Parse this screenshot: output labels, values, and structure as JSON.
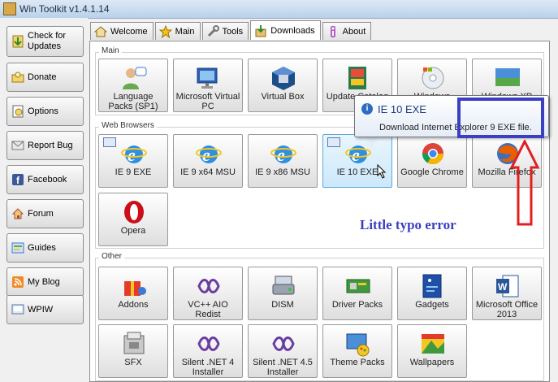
{
  "window": {
    "title": "Win Toolkit v1.4.1.14"
  },
  "sidebar": {
    "items": [
      {
        "label": "Check for Updates",
        "icon": "download-arrow-icon",
        "color": "#3d9b3d"
      },
      {
        "label": "Donate",
        "icon": "donate-icon",
        "color": "#d9a12e"
      },
      {
        "label": "Options",
        "icon": "options-icon",
        "color": "#3a6fb5"
      },
      {
        "label": "Report Bug",
        "icon": "report-bug-icon",
        "color": "#777777"
      },
      {
        "label": "Facebook",
        "icon": "facebook-icon",
        "color": "#3b5998"
      },
      {
        "label": "Forum",
        "icon": "forum-icon",
        "color": "#c0504d"
      },
      {
        "label": "Guides",
        "icon": "guides-icon",
        "color": "#6aa84f"
      },
      {
        "label": "My Blog",
        "icon": "blog-icon",
        "color": "#e8842a"
      },
      {
        "label": "WPIW",
        "icon": "wpiw-icon",
        "color": "#5577aa"
      }
    ]
  },
  "tabs": [
    {
      "label": "Welcome",
      "icon": "home-icon"
    },
    {
      "label": "Main",
      "icon": "star-icon"
    },
    {
      "label": "Tools",
      "icon": "tools-icon"
    },
    {
      "label": "Downloads",
      "icon": "downloads-icon",
      "active": true
    },
    {
      "label": "About",
      "icon": "info-icon"
    }
  ],
  "groups": {
    "main": {
      "title": "Main",
      "tiles": [
        {
          "label": "Language Packs (SP1)",
          "icon": "language-packs-icon"
        },
        {
          "label": "Microsoft Virtual PC",
          "icon": "virtual-pc-icon"
        },
        {
          "label": "Virtual Box",
          "icon": "virtualbox-icon"
        },
        {
          "label": "Update Catalog",
          "icon": "update-catalog-icon"
        },
        {
          "label": "Windows",
          "icon": "windows-disc-icon"
        },
        {
          "label": "Windows XP",
          "icon": "windows-xp-icon"
        }
      ]
    },
    "web": {
      "title": "Web Browsers",
      "tiles": [
        {
          "label": "IE 9 EXE",
          "icon": "ie-icon"
        },
        {
          "label": "IE 9 x64 MSU",
          "icon": "ie-icon"
        },
        {
          "label": "IE 9 x86 MSU",
          "icon": "ie-icon"
        },
        {
          "label": "IE 10 EXE",
          "icon": "ie-icon"
        },
        {
          "label": "Google Chrome",
          "icon": "chrome-icon"
        },
        {
          "label": "Mozilla Firefox",
          "icon": "firefox-icon"
        },
        {
          "label": "Opera",
          "icon": "opera-icon"
        }
      ]
    },
    "other": {
      "title": "Other",
      "tiles": [
        {
          "label": "Addons",
          "icon": "addons-icon"
        },
        {
          "label": "VC++ AIO Redist",
          "icon": "visual-studio-icon"
        },
        {
          "label": "DISM",
          "icon": "dism-icon"
        },
        {
          "label": "Driver Packs",
          "icon": "driver-packs-icon"
        },
        {
          "label": "Gadgets",
          "icon": "gadgets-icon"
        },
        {
          "label": "Microsoft Office 2013",
          "icon": "word-icon"
        },
        {
          "label": "SFX",
          "icon": "sfx-icon"
        },
        {
          "label": "Silent .NET 4 Installer",
          "icon": "dotnet-icon"
        },
        {
          "label": "Silent .NET 4.5 Installer",
          "icon": "dotnet-icon"
        },
        {
          "label": "Theme Packs",
          "icon": "theme-packs-icon"
        },
        {
          "label": "Wallpapers",
          "icon": "wallpapers-icon"
        }
      ]
    }
  },
  "tooltip": {
    "title": "IE 10 EXE",
    "description": "Download Internet Explorer 9 EXE file."
  },
  "annotation": {
    "text": "Little typo error",
    "color": "#3b3fc1",
    "arrow_color": "#e02020"
  }
}
